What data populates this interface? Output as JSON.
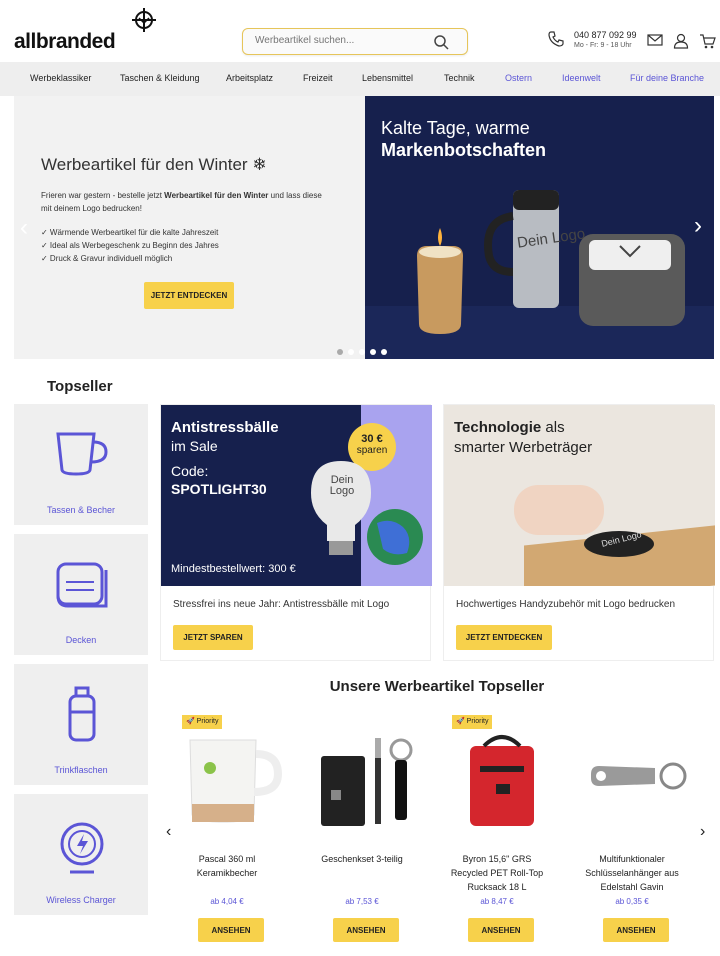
{
  "header": {
    "logo": "allbranded",
    "search_placeholder": "Werbeartikel suchen...",
    "phone": "040 877 092 99",
    "hours": "Mo - Fr: 9 - 18 Uhr"
  },
  "nav": [
    "Werbeklassiker",
    "Taschen & Kleidung",
    "Arbeitsplatz",
    "Freizeit",
    "Lebensmittel",
    "Technik",
    "Ostern",
    "Ideenwelt",
    "Für deine Branche"
  ],
  "hero": {
    "title": "Werbeartikel für den Winter ❄",
    "desc_pre": "Frieren war gestern - bestelle jetzt ",
    "desc_bold": "Werbeartikel für den Winter",
    "desc_post": " und lass diese mit deinem Logo bedrucken!",
    "bullets": [
      "✓ Wärmende Werbeartikel für die kalte Jahreszeit",
      "✓ Ideal als Werbegeschenk zu Beginn des Jahres",
      "✓ Druck & Gravur individuell möglich"
    ],
    "button": "JETZT ENTDECKEN",
    "banner_line1": "Kalte Tage, warme",
    "banner_line2": "Markenbotschaften",
    "mug_text": "Dein Logo"
  },
  "topseller_title": "Topseller",
  "categories": [
    "Tassen & Becher",
    "Decken",
    "Trinkflaschen",
    "Wireless Charger"
  ],
  "promos": [
    {
      "l1": "Antistressbälle",
      "l2": "im Sale",
      "l3": "Code:",
      "l4": "SPOTLIGHT30",
      "badge1": "30 €",
      "badge2": "sparen",
      "bulb": "Dein Logo",
      "foot": "Mindestbestellwert: 300 €",
      "desc": "Stressfrei ins neue Jahr: Antistressbälle mit Logo",
      "button": "JETZT SPAREN"
    },
    {
      "l1": "Technologie",
      "l1b": " als",
      "l2": "smarter Werbeträger",
      "pad": "Dein Logo",
      "desc": "Hochwertiges Handyzubehör mit Logo bedrucken",
      "button": "JETZT ENTDECKEN"
    }
  ],
  "tops_title": "Unsere Werbeartikel Topseller",
  "products": [
    {
      "badge": "🚀 Priority",
      "name1": "Pascal 360 ml",
      "name2": "Keramikbecher",
      "name3": "",
      "price": "ab 4,04 €",
      "button": "ANSEHEN"
    },
    {
      "badge": "",
      "name1": "Geschenkset 3-teilig",
      "name2": "",
      "name3": "",
      "price": "ab 7,53 €",
      "button": "ANSEHEN"
    },
    {
      "badge": "🚀 Priority",
      "name1": "Byron 15,6\" GRS",
      "name2": "Recycled PET Roll-Top",
      "name3": "Rucksack 18 L",
      "price": "ab 8,47 €",
      "button": "ANSEHEN"
    },
    {
      "badge": "",
      "name1": "Multifunktionaler",
      "name2": "Schlüsselanhänger aus",
      "name3": "Edelstahl Gavin",
      "price": "ab 0,35 €",
      "button": "ANSEHEN"
    }
  ],
  "colors": {
    "accent": "#5b55d6",
    "button": "#f7d14b",
    "banner": "#16204d"
  }
}
